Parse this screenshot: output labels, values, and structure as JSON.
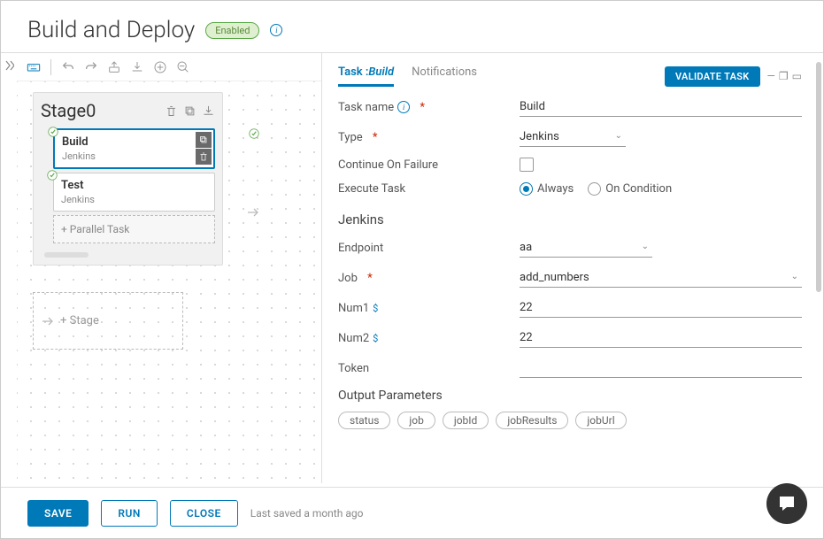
{
  "header": {
    "title": "Build and Deploy",
    "status": "Enabled"
  },
  "toolbar": {},
  "stage": {
    "name": "Stage0",
    "tasks": [
      {
        "name": "Build",
        "type": "Jenkins"
      },
      {
        "name": "Test",
        "type": "Jenkins"
      }
    ],
    "add_parallel": "+ Parallel Task",
    "add_stage": "+ Stage"
  },
  "panel": {
    "tabs": {
      "task_prefix": "Task :",
      "task_name": "Build",
      "notifications": "Notifications"
    },
    "validate": "VALIDATE TASK",
    "fields": {
      "task_name_label": "Task name",
      "task_name_value": "Build",
      "type_label": "Type",
      "type_value": "Jenkins",
      "continue_label": "Continue On Failure",
      "execute_label": "Execute Task",
      "always": "Always",
      "on_condition": "On Condition",
      "jenkins_section": "Jenkins",
      "endpoint_label": "Endpoint",
      "endpoint_value": "aa",
      "job_label": "Job",
      "job_value": "add_numbers",
      "num1_label": "Num1",
      "num1_value": "22",
      "num2_label": "Num2",
      "num2_value": "22",
      "token_label": "Token",
      "token_value": "",
      "output_title": "Output Parameters",
      "output_params": [
        "status",
        "job",
        "jobId",
        "jobResults",
        "jobUrl"
      ]
    }
  },
  "footer": {
    "save": "SAVE",
    "run": "RUN",
    "close": "CLOSE",
    "last_saved": "Last saved a month ago"
  }
}
